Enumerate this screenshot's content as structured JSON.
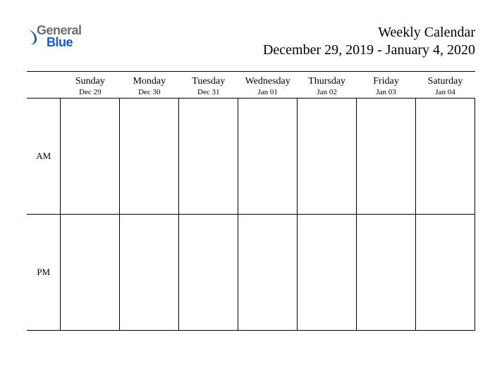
{
  "logo": {
    "line1": "General",
    "line2": "Blue"
  },
  "title": "Weekly Calendar",
  "date_range": "December 29, 2019 - January 4, 2020",
  "periods": [
    "AM",
    "PM"
  ],
  "days": [
    {
      "name": "Sunday",
      "date": "Dec 29"
    },
    {
      "name": "Monday",
      "date": "Dec 30"
    },
    {
      "name": "Tuesday",
      "date": "Dec 31"
    },
    {
      "name": "Wednesday",
      "date": "Jan 01"
    },
    {
      "name": "Thursday",
      "date": "Jan 02"
    },
    {
      "name": "Friday",
      "date": "Jan 03"
    },
    {
      "name": "Saturday",
      "date": "Jan 04"
    }
  ]
}
